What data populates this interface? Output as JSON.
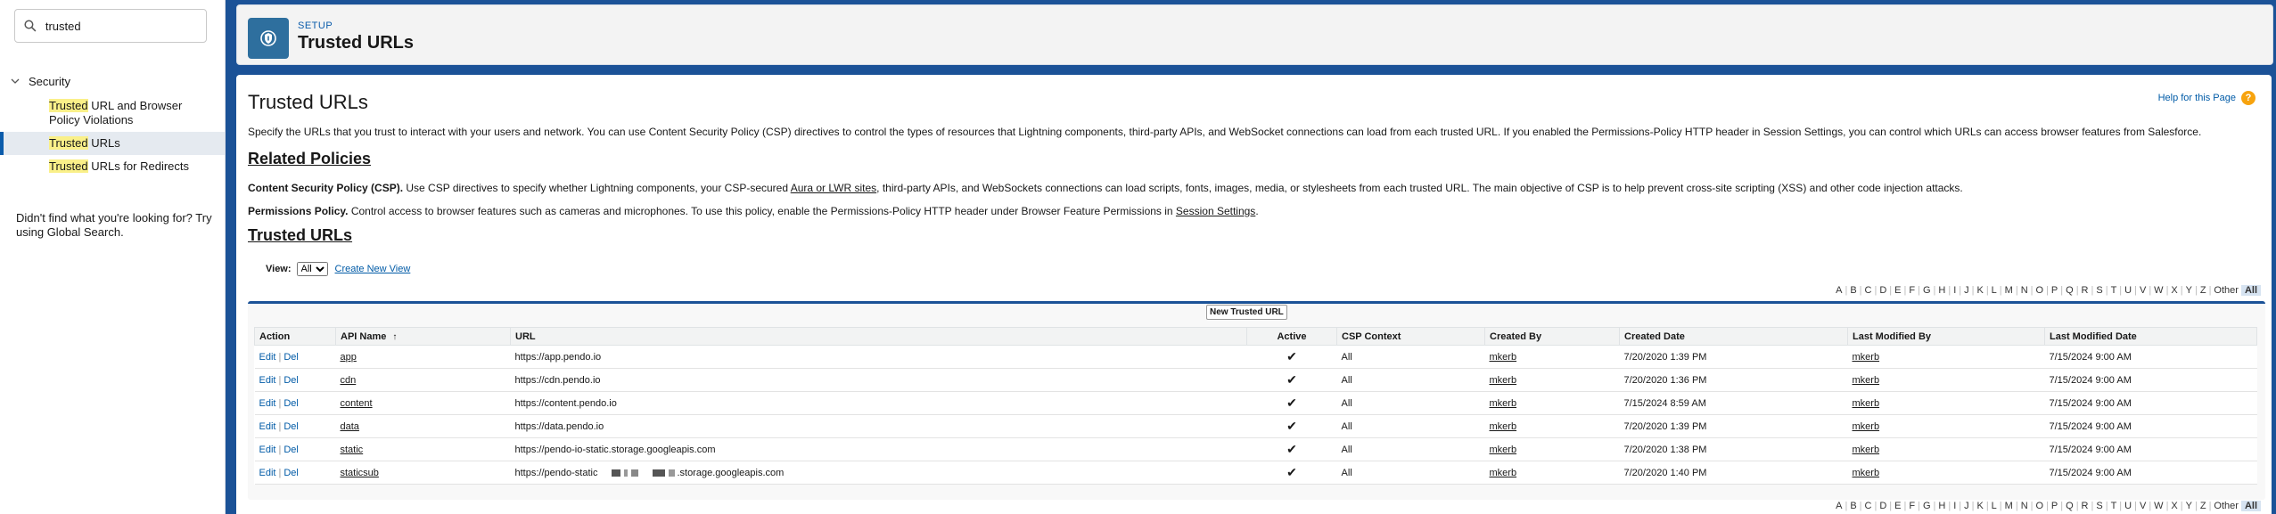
{
  "sidebar": {
    "search_value": "trusted",
    "group_label": "Security",
    "items": [
      {
        "hl": "Trusted",
        "rest": " URL and Browser Policy Violations"
      },
      {
        "hl": "Trusted",
        "rest": " URLs"
      },
      {
        "hl": "Trusted",
        "rest": " URLs for Redirects"
      }
    ],
    "not_found": "Didn't find what you're looking for? Try using Global Search."
  },
  "header": {
    "setup_label": "SETUP",
    "title": "Trusted URLs"
  },
  "content": {
    "title": "Trusted URLs",
    "help_link": "Help for this Page",
    "help_icon_glyph": "?",
    "description": "Specify the URLs that you trust to interact with your users and network. You can use Content Security Policy (CSP) directives to control the types of resources that Lightning components, third-party APIs, and WebSocket connections can load from each trusted URL. If you enabled the Permissions-Policy HTTP header in Session Settings, you can control which URLs can access browser features from Salesforce.",
    "related_policies_heading": "Related Policies",
    "csp_label": "Content Security Policy (CSP).",
    "csp_text_1": " Use CSP directives to specify whether Lightning components, your CSP-secured ",
    "csp_link": "Aura or LWR sites",
    "csp_text_2": ", third-party APIs, and WebSockets connections can load scripts, fonts, images, media, or stylesheets from each trusted URL. The main objective of CSP is to help prevent cross-site scripting (XSS) and other code injection attacks.",
    "perm_label": "Permissions Policy.",
    "perm_text": " Control access to browser features such as cameras and microphones. To use this policy, enable the Permissions-Policy HTTP header under Browser Feature Permissions in ",
    "perm_link": "Session Settings",
    "perm_end": ".",
    "trusted_heading": "Trusted URLs",
    "view_label": "View:",
    "view_value": "All",
    "create_view": "Create New View",
    "new_button": "New Trusted URL",
    "alphabet": [
      "A",
      "B",
      "C",
      "D",
      "E",
      "F",
      "G",
      "H",
      "I",
      "J",
      "K",
      "L",
      "M",
      "N",
      "O",
      "P",
      "Q",
      "R",
      "S",
      "T",
      "U",
      "V",
      "W",
      "X",
      "Y",
      "Z",
      "Other",
      "All"
    ]
  },
  "table": {
    "columns": [
      "Action",
      "API Name",
      "URL",
      "Active",
      "CSP Context",
      "Created By",
      "Created Date",
      "Last Modified By",
      "Last Modified Date"
    ],
    "sort_glyph": "↑",
    "edit_label": "Edit",
    "del_label": "Del",
    "action_sep": "|",
    "check_glyph": "✔",
    "rows": [
      {
        "api": "app",
        "url": "https://app.pendo.io",
        "csp": "All",
        "created_by": "mkerb",
        "created": "7/20/2020 1:39 PM",
        "mod_by": "mkerb",
        "modified": "7/15/2024 9:00 AM"
      },
      {
        "api": "cdn",
        "url": "https://cdn.pendo.io",
        "csp": "All",
        "created_by": "mkerb",
        "created": "7/20/2020 1:36 PM",
        "mod_by": "mkerb",
        "modified": "7/15/2024 9:00 AM"
      },
      {
        "api": "content",
        "url": "https://content.pendo.io",
        "csp": "All",
        "created_by": "mkerb",
        "created": "7/15/2024 8:59 AM",
        "mod_by": "mkerb",
        "modified": "7/15/2024 9:00 AM"
      },
      {
        "api": "data",
        "url": "https://data.pendo.io",
        "csp": "All",
        "created_by": "mkerb",
        "created": "7/20/2020 1:39 PM",
        "mod_by": "mkerb",
        "modified": "7/15/2024 9:00 AM"
      },
      {
        "api": "static",
        "url": "https://pendo-io-static.storage.googleapis.com",
        "csp": "All",
        "created_by": "mkerb",
        "created": "7/20/2020 1:38 PM",
        "mod_by": "mkerb",
        "modified": "7/15/2024 9:00 AM"
      },
      {
        "api": "staticsub",
        "url": "https://pendo-static",
        "url_tail": ".storage.googleapis.com",
        "csp": "All",
        "created_by": "mkerb",
        "created": "7/20/2020 1:40 PM",
        "mod_by": "mkerb",
        "modified": "7/15/2024 9:00 AM"
      }
    ]
  }
}
